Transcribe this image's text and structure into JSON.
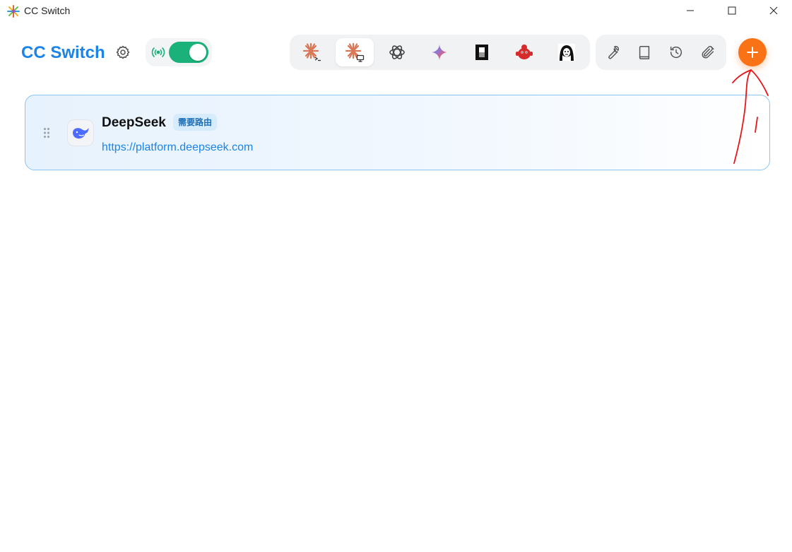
{
  "window": {
    "title": "CC Switch",
    "controls": {
      "minimize": "minimize-icon",
      "maximize": "maximize-icon",
      "close": "close-icon"
    }
  },
  "header": {
    "brand": "CC Switch",
    "settings_icon": "gear-icon",
    "proxy": {
      "icon": "broadcast-icon",
      "enabled": true
    },
    "apps": [
      {
        "name": "claude-code-icon",
        "active": false
      },
      {
        "name": "claude-desktop-icon",
        "active": true
      },
      {
        "name": "openai-icon",
        "active": false
      },
      {
        "name": "gemini-icon",
        "active": false
      },
      {
        "name": "opencode-icon",
        "active": false
      },
      {
        "name": "red-mascot-icon",
        "active": false
      },
      {
        "name": "character-avatar-icon",
        "active": false
      }
    ],
    "tools": [
      "wrench-icon",
      "book-icon",
      "history-icon",
      "paperclip-icon"
    ],
    "add_icon": "plus-icon"
  },
  "providers": [
    {
      "name": "DeepSeek",
      "badge": "需要路由",
      "url": "https://platform.deepseek.com",
      "icon": "deepseek-whale-icon"
    }
  ],
  "colors": {
    "brand": "#1a84e8",
    "toggle_on": "#1ab27a",
    "add_button": "#f97316",
    "card_border": "#8cc4f2",
    "badge_bg": "#d6ebfb",
    "annotation": "#e8141a"
  }
}
